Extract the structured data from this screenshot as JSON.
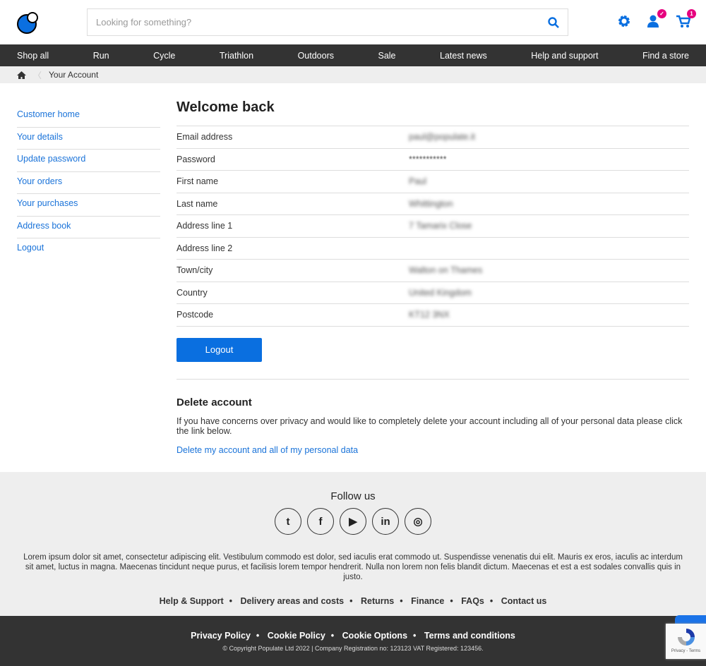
{
  "header": {
    "search_placeholder": "Looking for something?",
    "cart_count": "1"
  },
  "nav": [
    "Shop all",
    "Run",
    "Cycle",
    "Triathlon",
    "Outdoors",
    "Sale",
    "Latest news",
    "Help and support",
    "Find a store"
  ],
  "breadcrumb": {
    "current": "Your Account"
  },
  "sidebar": [
    "Customer home",
    "Your details",
    "Update password",
    "Your orders",
    "Your purchases",
    "Address book",
    "Logout"
  ],
  "account": {
    "title": "Welcome back",
    "rows": [
      {
        "label": "Email address",
        "value": "paul@populate.it"
      },
      {
        "label": "Password",
        "value": "***********"
      },
      {
        "label": "First name",
        "value": "Paul"
      },
      {
        "label": "Last name",
        "value": "Whittington"
      },
      {
        "label": "Address line 1",
        "value": "7 Tamarix Close"
      },
      {
        "label": "Address line 2",
        "value": ""
      },
      {
        "label": "Town/city",
        "value": "Walton on Thames"
      },
      {
        "label": "Country",
        "value": "United Kingdom"
      },
      {
        "label": "Postcode",
        "value": "KT12 3NX"
      }
    ],
    "logout_label": "Logout"
  },
  "delete": {
    "title": "Delete account",
    "text": "If you have concerns over privacy and would like to completely delete your account including all of your personal data please click the link below.",
    "link": "Delete my account and all of my personal data"
  },
  "footer": {
    "follow": "Follow us",
    "social": [
      "twitter",
      "facebook",
      "youtube",
      "linkedin",
      "instagram"
    ],
    "lorem": "Lorem ipsum dolor sit amet, consectetur adipiscing elit. Vestibulum commodo est dolor, sed iaculis erat commodo ut. Suspendisse venenatis dui elit. Mauris ex eros, iaculis ac interdum sit amet, luctus in magna. Maecenas tincidunt neque purus, et facilisis lorem tempor hendrerit. Nulla non lorem non felis blandit dictum. Maecenas et est a est sodales convallis quis in justo.",
    "links": [
      "Help & Support",
      "Delivery areas and costs",
      "Returns",
      "Finance",
      "FAQs",
      "Contact us"
    ],
    "legal": [
      "Privacy Policy",
      "Cookie Policy",
      "Cookie Options",
      "Terms and conditions"
    ],
    "copyright": "© Copyright Populate Ltd 2022 | Company Registration no: 123123 VAT Registered: 123456.",
    "recaptcha": "Privacy - Terms"
  },
  "colors": {
    "accent": "#0a6fe0",
    "nav_bg": "#333333",
    "badge": "#e6007e"
  }
}
